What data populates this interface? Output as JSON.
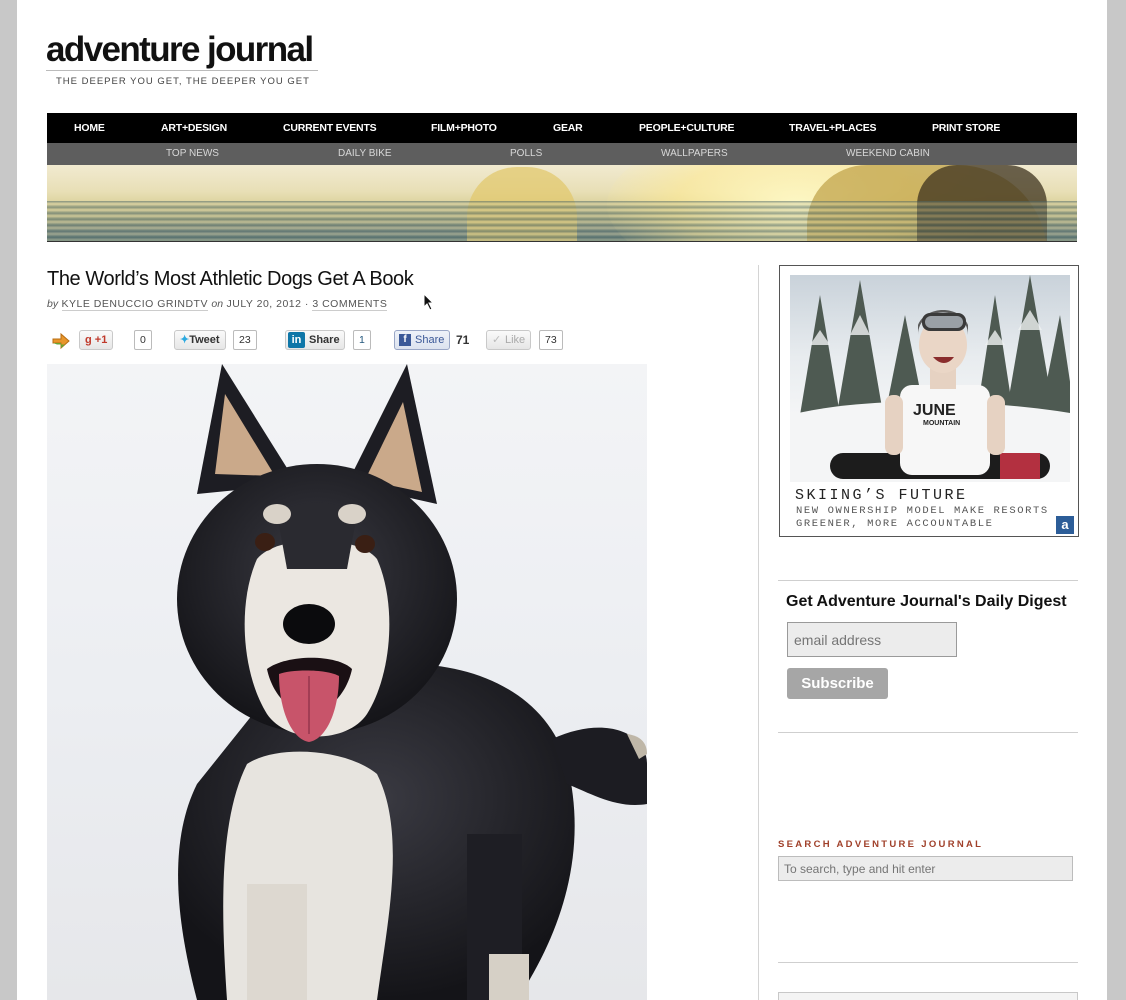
{
  "site": {
    "logo": "adventure journal",
    "tagline": "THE DEEPER YOU GET, THE DEEPER YOU GET"
  },
  "nav": {
    "primary": [
      "HOME",
      "ART+DESIGN",
      "CURRENT EVENTS",
      "FILM+PHOTO",
      "GEAR",
      "PEOPLE+CULTURE",
      "TRAVEL+PLACES",
      "PRINT STORE"
    ],
    "secondary": [
      "TOP NEWS",
      "DAILY BIKE",
      "POLLS",
      "WALLPAPERS",
      "WEEKEND CABIN"
    ]
  },
  "post": {
    "title": "The World’s Most Athletic Dogs Get A Book",
    "by_prefix": "by",
    "author": "KYLE DENUCCIO GRINDTV",
    "on_word": "on",
    "date": "JULY 20, 2012",
    "separator": "·",
    "comments": "3 COMMENTS"
  },
  "share": {
    "gplus_label": "+1",
    "gplus_count": "0",
    "tweet_label": "Tweet",
    "tweet_count": "23",
    "linkedin_label": "Share",
    "linkedin_count": "1",
    "facebook_share_label": "Share",
    "facebook_share_count": "71",
    "like_label": "Like",
    "like_count": "73"
  },
  "ad": {
    "shirt_text": "JUNE",
    "shirt_sub": "MOUNTAIN",
    "headline": "SKIING’S FUTURE",
    "subhead": "NEW OWNERSHIP MODEL MAKE RESORTS GREENER, MORE ACCOUNTABLE",
    "badge": "a"
  },
  "newsletter": {
    "title": "Get Adventure Journal's Daily Digest",
    "email_placeholder": "email address",
    "button": "Subscribe"
  },
  "search": {
    "label": "SEARCH ADVENTURE JOURNAL",
    "placeholder": "To search, type and hit enter"
  },
  "colors": {
    "nav_bg": "#000000",
    "subnav_bg": "#5e5e5e",
    "search_label": "#a0402a",
    "subscribe_btn": "#a6a6a6"
  }
}
